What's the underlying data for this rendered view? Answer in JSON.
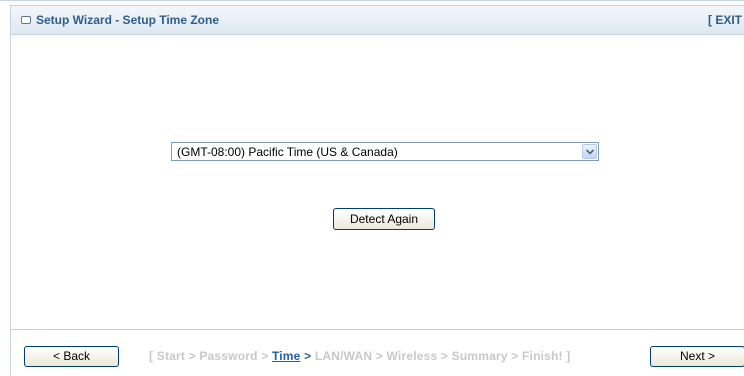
{
  "header": {
    "title": "Setup Wizard - Setup Time Zone",
    "exit_label": "[ EXIT"
  },
  "timezone": {
    "selected": "(GMT-08:00) Pacific Time (US & Canada)"
  },
  "detect_label": "Detect Again",
  "footer": {
    "back_label": "< Back",
    "next_label": "Next >",
    "steps": {
      "open": "[ ",
      "start": "Start",
      "sep1": " > ",
      "password": "Password",
      "sep2": " > ",
      "time": "Time",
      "sep3": " > ",
      "lanwan": "LAN/WAN",
      "sep4": " > ",
      "wireless": "Wireless",
      "sep5": " > ",
      "summary": "Summary",
      "sep6": " > ",
      "finish": "Finish!",
      "close": " ]"
    }
  },
  "colors": {
    "title": "#2f5d8c",
    "current_step": "#1f5fa8",
    "inactive_step": "#c8c8c8"
  }
}
